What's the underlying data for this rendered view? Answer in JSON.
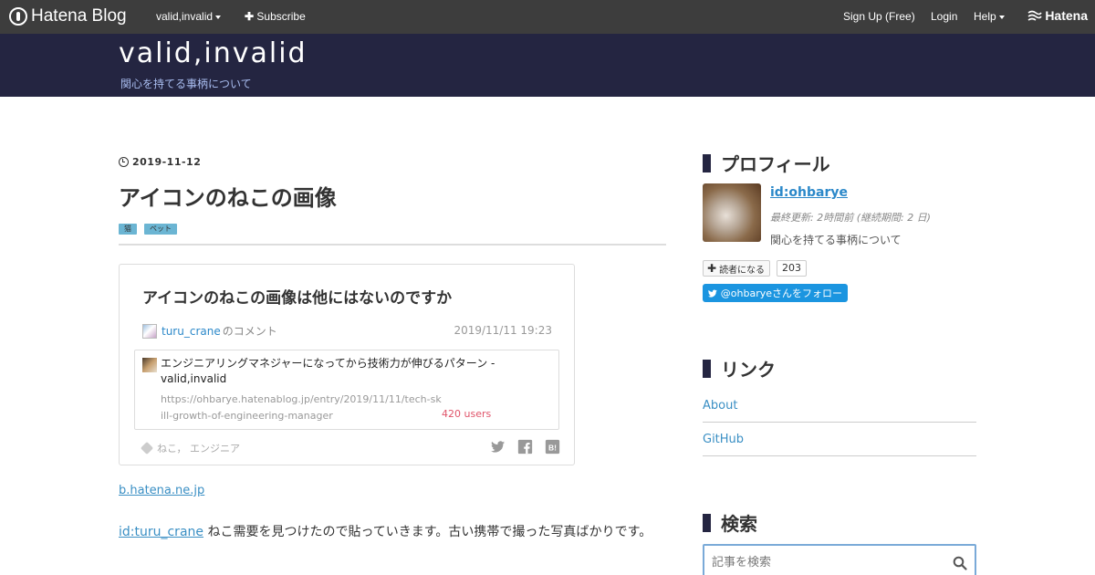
{
  "globalbar": {
    "logo": "Hatena Blog",
    "blog_menu": "valid,invalid",
    "subscribe": "Subscribe",
    "signup": "Sign Up (Free)",
    "login": "Login",
    "help": "Help",
    "hatena": "Hatena"
  },
  "blog": {
    "title": "valid,invalid",
    "description": "関心を持てる事柄について"
  },
  "entry": {
    "date": "2019-11-12",
    "title": "アイコンのねこの画像",
    "categories": [
      "猫",
      "ペット"
    ],
    "card": {
      "title": "アイコンのねこの画像は他にはないのですか",
      "username": "turu_crane",
      "user_suffix": "のコメント",
      "datetime": "2019/11/11 19:23",
      "linked_title": "エンジニアリングマネジャーになってから技術力が伸びるパターン - valid,invalid",
      "linked_url": "https://ohbarye.hatenablog.jp/entry/2019/11/11/tech-skill-growth-of-engineering-manager",
      "linked_users": "420 users",
      "tags": "ねこ， エンジニア"
    },
    "source_link": "b.hatena.ne.jp",
    "body_link": "id:turu_crane",
    "body_text": " ねこ需要を見つけたので貼っていきます。古い携帯で撮った写真ばかりです。"
  },
  "sidebar": {
    "profile": {
      "heading": "プロフィール",
      "id": "id:ohbarye",
      "updated": "最終更新: 2時間前 (継続期間: 2 日)",
      "description": "関心を持てる事柄について",
      "subscribe_label": "読者になる",
      "subscribe_count": "203",
      "twitter_label": "@ohbaryeさんをフォロー"
    },
    "links": {
      "heading": "リンク",
      "items": [
        "About",
        "GitHub"
      ]
    },
    "search": {
      "heading": "検索",
      "placeholder": "記事を検索"
    }
  },
  "colors": {
    "header_bg": "#242541",
    "globalbar_bg": "#3d3d3d",
    "link": "#3a8fc4",
    "category": "#6bb5d3",
    "twitter": "#1b95e0",
    "users": "#e0546a"
  }
}
